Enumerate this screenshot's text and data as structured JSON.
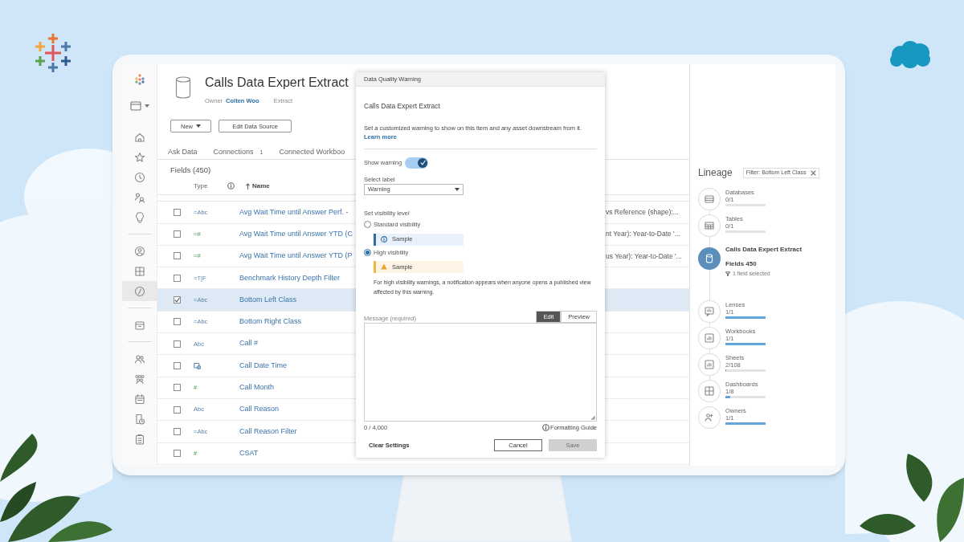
{
  "nav": [
    {
      "selected": false
    },
    {
      "selected": false
    },
    {
      "selected": false
    },
    {
      "selected": false
    },
    {
      "selected": false
    },
    {
      "selected": false
    },
    {
      "selected": false
    },
    {
      "selected": true
    },
    {
      "selected": false
    },
    {
      "selected": false
    },
    {
      "selected": false
    },
    {
      "selected": false
    },
    {
      "selected": false
    },
    {
      "selected": false
    }
  ],
  "header": {
    "title": "Calls Data Expert Extract",
    "owner_label": "Owner",
    "owner": "Colten Woo",
    "type": "Extract"
  },
  "buttons": [
    {
      "label": "New",
      "kind": "dropdown"
    },
    {
      "label": "Edit Data Source",
      "kind": "plain"
    }
  ],
  "tabs": [
    {
      "label": "Ask Data",
      "selected": false
    },
    {
      "label": "Connections",
      "count": "1",
      "selected": false
    },
    {
      "label": "Connected Workboo",
      "selected": false
    }
  ],
  "fields": {
    "title": "Fields (450)",
    "columns": [
      "Type",
      "Name"
    ],
    "rows": [
      {
        "kind": "text",
        "type_label": "=Abc",
        "name": "Avg Wait Time until Answer Perf. -",
        "description": "vs Reference (shape):...",
        "checked": false,
        "selected": false
      },
      {
        "kind": "number",
        "type_label": "=#",
        "name": "Avg Wait Time until Answer YTD (C",
        "description": "nt Year): Year-to-Date '...",
        "checked": false,
        "selected": false
      },
      {
        "kind": "number",
        "type_label": "=#",
        "name": "Avg Wait Time until Answer YTD (P",
        "description": "us Year): Year-to-Date '...",
        "checked": false,
        "selected": false
      },
      {
        "kind": "boolean",
        "type_label": "=T|F",
        "name": "Benchmark History Depth Filter",
        "checked": false,
        "selected": false
      },
      {
        "kind": "text",
        "type_label": "=Abc",
        "name": "Bottom Left Class",
        "checked": true,
        "selected": true
      },
      {
        "kind": "text",
        "type_label": "=Abc",
        "name": "Bottom Right Class",
        "checked": false,
        "selected": false
      },
      {
        "kind": "text",
        "type_label": "Abc",
        "name": "Call #",
        "checked": false,
        "selected": false
      },
      {
        "kind": "datetime",
        "name": "Call Date Time",
        "checked": false,
        "selected": false
      },
      {
        "kind": "number",
        "type_label": "#",
        "name": "Call Month",
        "checked": false,
        "selected": false
      },
      {
        "kind": "text",
        "type_label": "Abc",
        "name": "Call Reason",
        "checked": false,
        "selected": false
      },
      {
        "kind": "text",
        "type_label": "=Abc",
        "name": "Call Reason Filter",
        "checked": false,
        "selected": false
      },
      {
        "kind": "number",
        "type_label": "#",
        "name": "CSAT",
        "checked": false,
        "selected": false
      }
    ]
  },
  "dialog": {
    "title": "Data Quality Warning",
    "heading": "Calls Data Expert Extract",
    "description": "Set a customized warning to show on this item and any asset downstream from it.",
    "link": "Learn more",
    "toggle": {
      "label": "Show warning",
      "on": true
    },
    "select": {
      "label": "Select label",
      "value": "Warning"
    },
    "visibility": {
      "label": "Set visibility level",
      "options": [
        {
          "label": "Standard visibility",
          "selected": false,
          "sample": "Sample",
          "kind": "info"
        },
        {
          "label": "High visibility",
          "selected": true,
          "sample": "Sample",
          "kind": "warning"
        }
      ]
    },
    "note": "For high visibility warnings, a notification appears when anyone opens a published view affected by this warning.",
    "message": {
      "label": "Message (required)",
      "modes": [
        {
          "label": "Edit",
          "selected": true
        },
        {
          "label": "Preview",
          "selected": false
        }
      ],
      "counter": "0 / 4,000",
      "guide": "Formatting Guide"
    },
    "actions": [
      {
        "label": "Clear Settings",
        "kind": "link",
        "disabled": false
      },
      {
        "label": "Cancel",
        "kind": "secondary",
        "disabled": false
      },
      {
        "label": "Save",
        "kind": "primary",
        "disabled": true
      }
    ]
  },
  "lineage": {
    "title": "Lineage",
    "filter": "Filter: Bottom Left Class",
    "items": [
      {
        "kind": "node",
        "label": "Databases",
        "count": "0/1",
        "level": 0
      },
      {
        "kind": "node",
        "label": "Tables",
        "count": "0/1",
        "level": 0
      },
      {
        "kind": "current",
        "label": "Calls Data Expert Extract",
        "fields": "Fields 450",
        "selection": "1 field selected"
      },
      {
        "kind": "node",
        "label": "Lenses",
        "count": "1/1",
        "level": 1
      },
      {
        "kind": "node",
        "label": "Workbooks",
        "count": "1/1",
        "level": 1
      },
      {
        "kind": "node",
        "label": "Sheets",
        "count": "2/108",
        "level": 0.02
      },
      {
        "kind": "node",
        "label": "Dashboards",
        "count": "1/8",
        "level": 0.125
      },
      {
        "kind": "node",
        "label": "Owners",
        "count": "1/1",
        "level": 1
      }
    ]
  }
}
